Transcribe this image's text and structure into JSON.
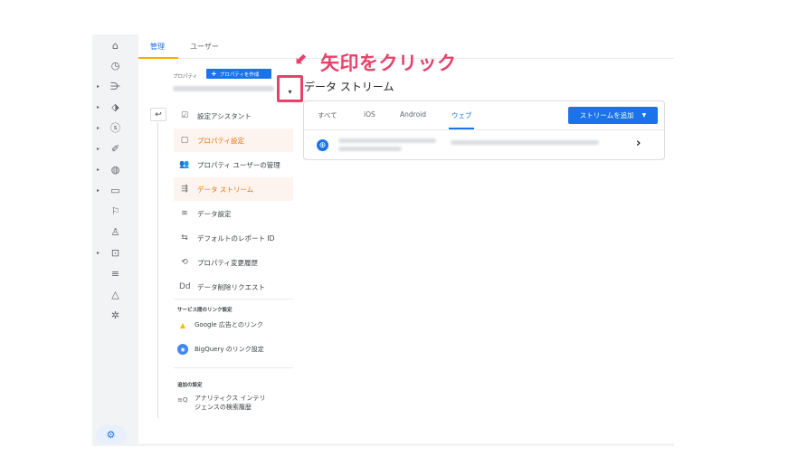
{
  "top_tabs": {
    "admin": "管理",
    "users": "ユーザー"
  },
  "property": {
    "label": "プロパティ",
    "create_button": "プロパティを作成",
    "dropdown_arrow": "▾"
  },
  "annotation": {
    "text": "矢印をクリック",
    "arrow": "⬋",
    "color": "#e8416b"
  },
  "back_icon": "↩",
  "menu": {
    "items": [
      {
        "label": "設定アシスタント",
        "icon": "☑"
      },
      {
        "label": "プロパティ設定",
        "icon": "▢"
      },
      {
        "label": "プロパティ ユーザーの管理",
        "icon": "👥"
      },
      {
        "label": "データ ストリーム",
        "icon": "⇶"
      },
      {
        "label": "データ設定",
        "icon": "≋"
      },
      {
        "label": "デフォルトのレポート ID",
        "icon": "⇆"
      },
      {
        "label": "プロパティ変更履歴",
        "icon": "⟲"
      },
      {
        "label": "データ削除リクエスト",
        "icon": "Dd"
      }
    ],
    "service_links_title": "サービス間のリンク設定",
    "service_links": [
      {
        "label": "Google 広告とのリンク"
      },
      {
        "label": "BigQuery のリンク設定"
      }
    ],
    "additional_title": "追加の設定",
    "search_history": {
      "line1": "アナリティクス インテリ",
      "line2": "ジェンスの検索履歴"
    }
  },
  "main": {
    "title": "データ ストリーム",
    "tabs": [
      "すべて",
      "iOS",
      "Android",
      "ウェブ"
    ],
    "add_stream_button": "ストリームを追加",
    "row_chevron": "›"
  },
  "colors": {
    "accent": "#1a73e8",
    "active_menu": "#e8710a",
    "highlight": "#e8416b",
    "tab_underline": "#f9ab00"
  }
}
